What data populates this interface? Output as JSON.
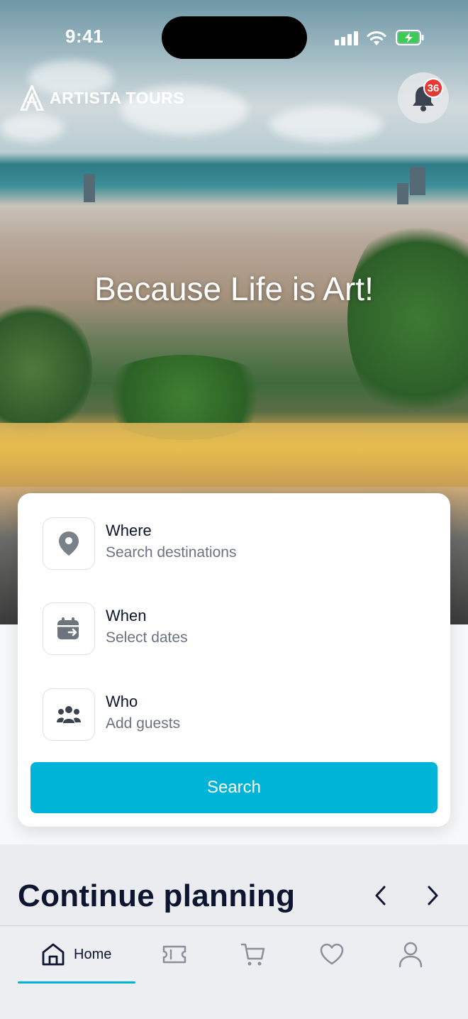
{
  "status": {
    "time": "9:41"
  },
  "brand": {
    "name": "ARTISTA TOURS"
  },
  "notifications": {
    "count": "36"
  },
  "hero": {
    "tagline": "Because Life is Art!"
  },
  "search_card": {
    "where": {
      "label": "Where",
      "placeholder": "Search destinations"
    },
    "when": {
      "label": "When",
      "placeholder": "Select dates"
    },
    "who": {
      "label": "Who",
      "placeholder": "Add guests"
    },
    "button_label": "Search"
  },
  "continue_planning": {
    "title": "Continue planning"
  },
  "bottom_nav": {
    "items": [
      {
        "label": "Home",
        "icon": "home-icon",
        "active": true
      },
      {
        "label": "",
        "icon": "ticket-icon"
      },
      {
        "label": "",
        "icon": "cart-icon"
      },
      {
        "label": "",
        "icon": "heart-icon"
      },
      {
        "label": "",
        "icon": "user-icon"
      }
    ]
  },
  "colors": {
    "accent": "#00b4d8",
    "badge": "#e53935",
    "text_dark": "#0d1530",
    "text_muted": "#6b7280"
  }
}
